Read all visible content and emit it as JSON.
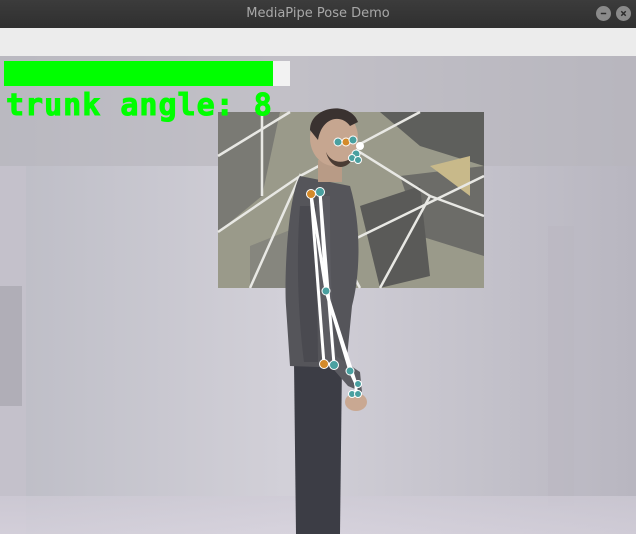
{
  "window": {
    "title": "MediaPipe Pose Demo",
    "buttons": [
      "minimize-icon",
      "close-icon"
    ]
  },
  "overlay": {
    "progress": 0.94,
    "bar_color": "#00ff00",
    "text": "trunk angle: 8"
  },
  "colors": {
    "landmark_orange": "#d48a2a",
    "landmark_teal": "#4aa0a0",
    "connection_white": "#ffffff"
  }
}
